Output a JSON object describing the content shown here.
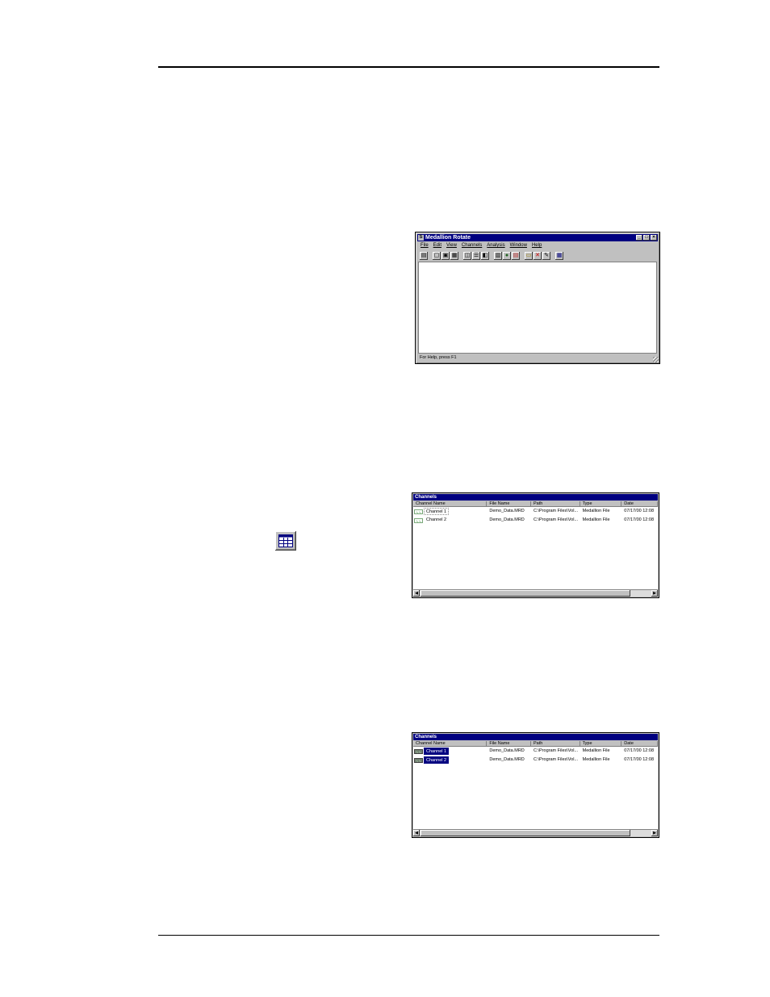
{
  "app_window": {
    "title": "Medallion Rotate",
    "menu": [
      "File",
      "Edit",
      "View",
      "Channels",
      "Analysis",
      "Window",
      "Help"
    ],
    "status": "For Help, press F1",
    "title_buttons": [
      "_",
      "□",
      "×"
    ]
  },
  "channels_window_1": {
    "title": "Channels",
    "columns": [
      "Channel Name",
      "File Name",
      "Path",
      "Type",
      "Date"
    ],
    "rows": [
      {
        "channel": "Channel 1",
        "file": "Demo_Data.MRD",
        "path": "C:\\Program Files\\Vol...",
        "type": "Medallion File",
        "date": "07/17/00 12:08"
      },
      {
        "channel": "Channel 2",
        "file": "Demo_Data.MRD",
        "path": "C:\\Program Files\\Vol...",
        "type": "Medallion File",
        "date": "07/17/00 12:08"
      }
    ],
    "selected": [
      false,
      false
    ]
  },
  "channels_window_2": {
    "title": "Channels",
    "columns": [
      "Channel Name",
      "File Name",
      "Path",
      "Type",
      "Date"
    ],
    "rows": [
      {
        "channel": "Channel 1",
        "file": "Demo_Data.MRD",
        "path": "C:\\Program Files\\Vol...",
        "type": "Medallion File",
        "date": "07/17/00 12:08"
      },
      {
        "channel": "Channel 2",
        "file": "Demo_Data.MRD",
        "path": "C:\\Program Files\\Vol...",
        "type": "Medallion File",
        "date": "07/17/00 12:08"
      }
    ],
    "selected": [
      true,
      true
    ]
  },
  "colors": {
    "titlebar": "#000080",
    "face": "#c0c0c0",
    "selection": "#000080"
  }
}
